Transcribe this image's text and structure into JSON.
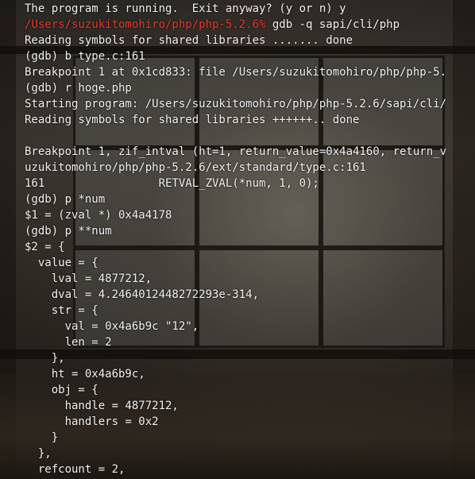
{
  "colors": {
    "text": "#f2f2f2",
    "prompt": "#e8392f"
  },
  "terminal": {
    "lines": [
      {
        "text": "The program is running.  Exit anyway? (y or n) y"
      },
      {
        "prompt": "/Users/suzukitomohiro/php/php-5.2.6%",
        "text": " gdb -q sapi/cli/php"
      },
      {
        "text": "Reading symbols for shared libraries ....... done"
      },
      {
        "text": "(gdb) b type.c:161"
      },
      {
        "text": "Breakpoint 1 at 0x1cd833: file /Users/suzukitomohiro/php/php-5."
      },
      {
        "text": "(gdb) r hoge.php"
      },
      {
        "text": "Starting program: /Users/suzukitomohiro/php/php-5.2.6/sapi/cli/"
      },
      {
        "text": "Reading symbols for shared libraries ++++++.. done"
      },
      {
        "text": ""
      },
      {
        "text": "Breakpoint 1, zif_intval (ht=1, return_value=0x4a4160, return_v"
      },
      {
        "text": "uzukitomohiro/php/php-5.2.6/ext/standard/type.c:161"
      },
      {
        "text": "161                 RETVAL_ZVAL(*num, 1, 0);"
      },
      {
        "text": "(gdb) p *num"
      },
      {
        "text": "$1 = (zval *) 0x4a4178"
      },
      {
        "text": "(gdb) p **num"
      },
      {
        "text": "$2 = {"
      },
      {
        "text": "  value = {"
      },
      {
        "text": "    lval = 4877212,"
      },
      {
        "text": "    dval = 4.2464012448272293e-314,"
      },
      {
        "text": "    str = {"
      },
      {
        "text": "      val = 0x4a6b9c \"12\","
      },
      {
        "text": "      len = 2"
      },
      {
        "text": "    },"
      },
      {
        "text": "    ht = 0x4a6b9c,"
      },
      {
        "text": "    obj = {"
      },
      {
        "text": "      handle = 4877212,"
      },
      {
        "text": "      handlers = 0x2"
      },
      {
        "text": "    }"
      },
      {
        "text": "  },"
      },
      {
        "text": "  refcount = 2,"
      }
    ]
  }
}
